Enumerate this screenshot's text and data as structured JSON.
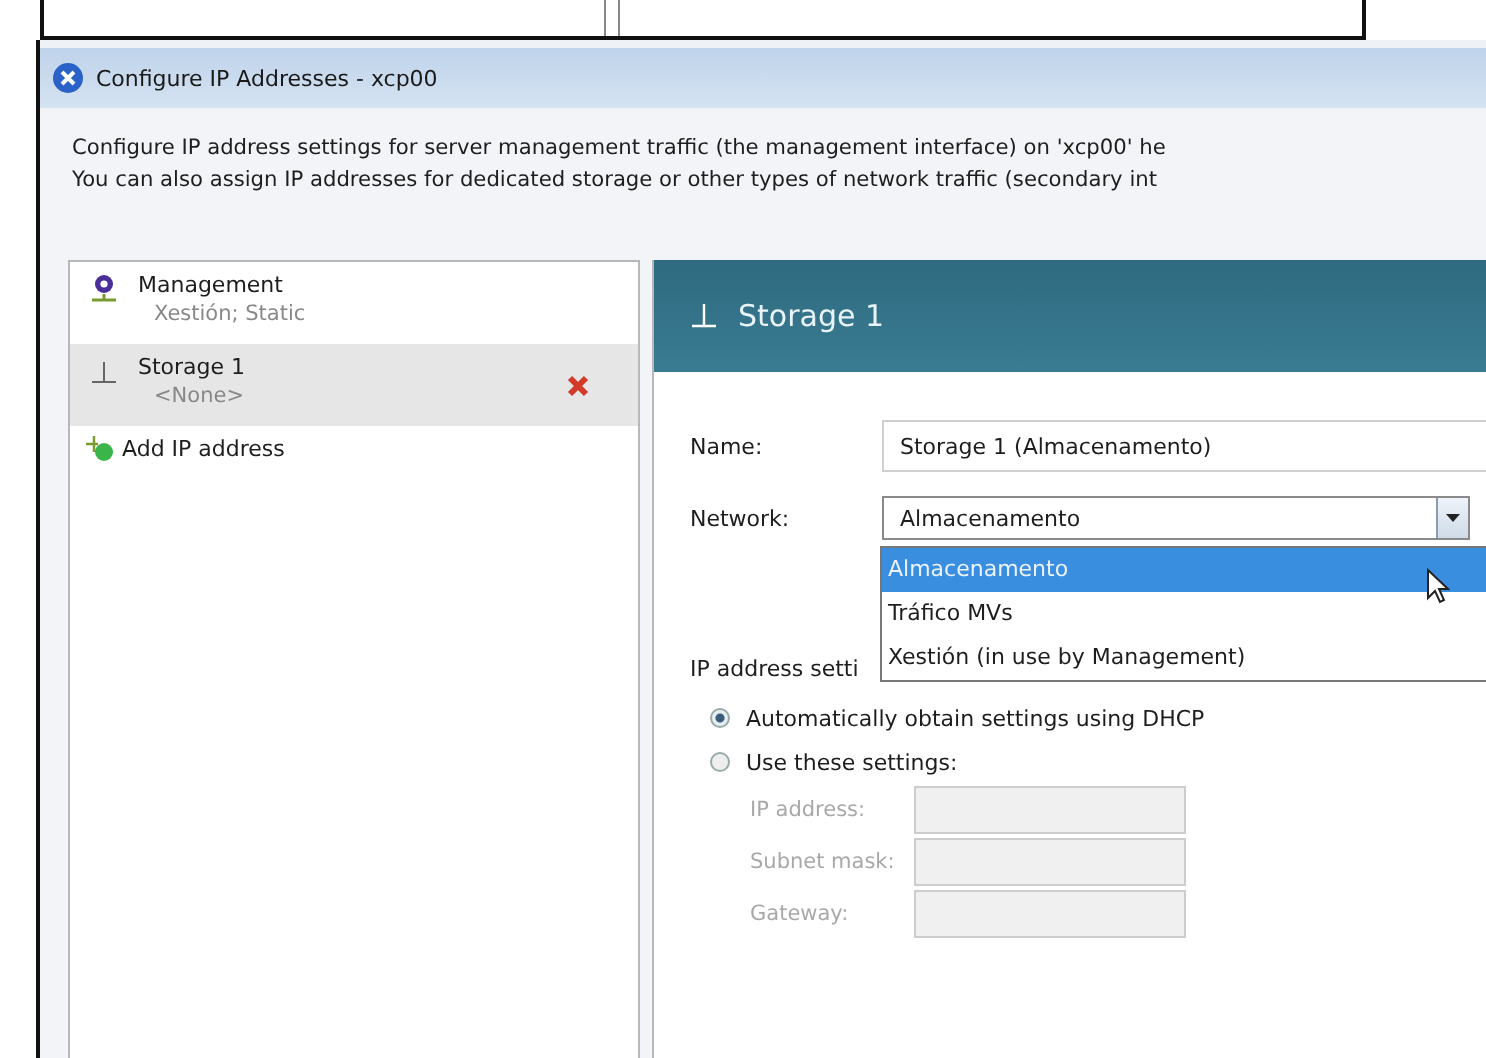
{
  "window": {
    "title": "Configure IP Addresses - xcp00"
  },
  "description": [
    "Configure IP address settings for server management traffic (the management interface) on 'xcp00' he",
    "You can also assign IP addresses for dedicated storage or other types of network traffic (secondary int"
  ],
  "interfaces": [
    {
      "kind": "management",
      "name": "Management",
      "detail": "Xestión; Static",
      "selected": false,
      "removable": false
    },
    {
      "kind": "storage",
      "name": "Storage 1",
      "detail": "<None>",
      "selected": true,
      "removable": true
    }
  ],
  "add_link": "Add IP address",
  "detail": {
    "title": "Storage 1",
    "name_label": "Name:",
    "name_value": "Storage 1 (Almacenamento)",
    "network_label": "Network:",
    "network_value": "Almacenamento",
    "network_options": [
      {
        "label": "Almacenamento",
        "selected": true
      },
      {
        "label": "Tráfico MVs",
        "selected": false
      },
      {
        "label": "Xestión (in use by Management)",
        "selected": false
      }
    ],
    "ip_label": "IP address setti",
    "modes": [
      {
        "label": "Automatically obtain settings using DHCP",
        "selected": true
      },
      {
        "label": "Use these settings:",
        "selected": false
      }
    ],
    "fields": [
      {
        "label": "IP address:",
        "disabled": true
      },
      {
        "label": "Subnet mask:",
        "disabled": true
      },
      {
        "label": "Gateway:",
        "disabled": true
      }
    ]
  }
}
